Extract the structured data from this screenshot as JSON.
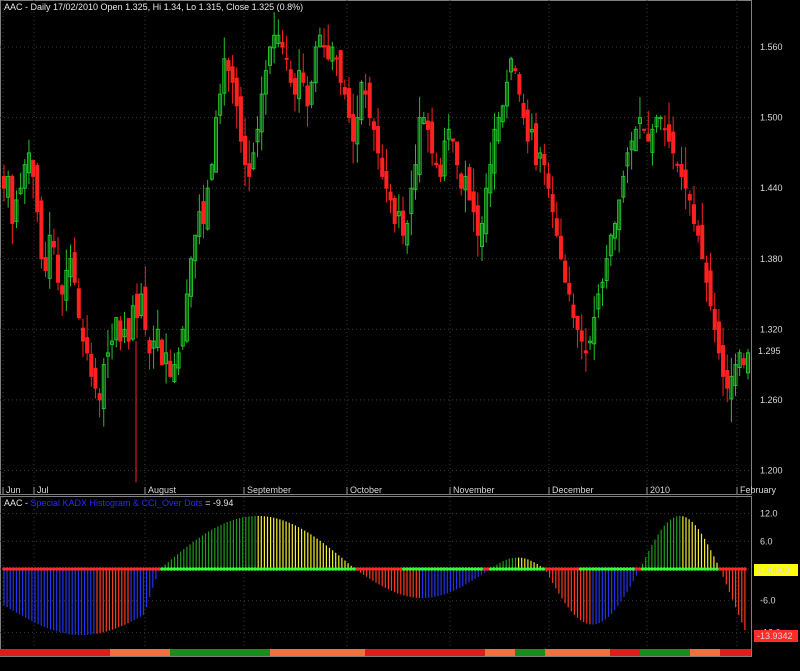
{
  "colors": {
    "background": "#000000",
    "grid": "#3a3a3a",
    "frame": "#7f7f7f",
    "candle_up": "#22c32a",
    "candle_down": "#ff2020",
    "hist_blue": "#2233ee",
    "hist_red": "#ff3a1f",
    "hist_green": "#1f9a1f",
    "hist_yellow": "#f5ef30",
    "dot_green": "#35ff35",
    "dot_red": "#ff2a2a",
    "title_ind": "#2b2bff",
    "strip_red": "#e21a1a",
    "strip_orange": "#f07040",
    "strip_green": "#1b8c1b",
    "last_price_bg": "#000000",
    "zero_tag_bg": "#ffff00",
    "neg_tag_bg": "#ff2a2a"
  },
  "price_panel": {
    "header": "AAC - Daily 17/02/2010 Open 1.325, Hi 1.34, Lo 1.315, Close 1.325 (0.8%)",
    "y_ticks": [
      "1.560",
      "1.500",
      "1.440",
      "1.380",
      "1.320",
      "1.260",
      "1.200"
    ],
    "last_price_label": "1.295",
    "x_labels": [
      "Jun",
      "Jul",
      "August",
      "September",
      "October",
      "November",
      "December",
      "2010",
      "February"
    ]
  },
  "indicator_panel": {
    "header_prefix": "AAC - ",
    "header_name": "Special KADX Histogram & CCI_Over Dots",
    "header_value": " = -9.94",
    "y_ticks": [
      "12.0",
      "6.0",
      "0",
      "-6.0",
      "-12.0"
    ],
    "zero_tag": "0.00000",
    "value_tag": "-13.9342"
  },
  "chart_data": [
    {
      "type": "candlestick",
      "title": "AAC - Daily 17/02/2010 Open 1.325, Hi 1.34, Lo 1.315, Close 1.325 (0.8%)",
      "ylim": [
        1.18,
        1.6
      ],
      "x_labels": [
        "Jun",
        "Jul",
        "August",
        "September",
        "October",
        "November",
        "December",
        "2010",
        "February"
      ],
      "last_close": 1.295,
      "closes_approx": [
        1.44,
        1.45,
        1.41,
        1.43,
        1.44,
        1.46,
        1.47,
        1.45,
        1.42,
        1.38,
        1.37,
        1.4,
        1.39,
        1.36,
        1.35,
        1.37,
        1.38,
        1.36,
        1.33,
        1.31,
        1.3,
        1.28,
        1.27,
        1.26,
        1.29,
        1.3,
        1.31,
        1.33,
        1.31,
        1.32,
        1.31,
        1.34,
        1.33,
        1.35,
        1.32,
        1.3,
        1.31,
        1.32,
        1.29,
        1.3,
        1.28,
        1.29,
        1.3,
        1.32,
        1.35,
        1.38,
        1.4,
        1.42,
        1.41,
        1.44,
        1.46,
        1.5,
        1.52,
        1.55,
        1.54,
        1.53,
        1.51,
        1.48,
        1.46,
        1.45,
        1.47,
        1.49,
        1.52,
        1.54,
        1.56,
        1.57,
        1.57,
        1.56,
        1.55,
        1.53,
        1.52,
        1.54,
        1.53,
        1.51,
        1.53,
        1.56,
        1.57,
        1.56,
        1.55,
        1.56,
        1.55,
        1.53,
        1.52,
        1.5,
        1.48,
        1.5,
        1.53,
        1.52,
        1.5,
        1.49,
        1.47,
        1.45,
        1.44,
        1.43,
        1.41,
        1.42,
        1.4,
        1.41,
        1.44,
        1.46,
        1.5,
        1.5,
        1.49,
        1.47,
        1.46,
        1.45,
        1.48,
        1.49,
        1.48,
        1.46,
        1.44,
        1.45,
        1.43,
        1.42,
        1.4,
        1.41,
        1.44,
        1.46,
        1.49,
        1.5,
        1.51,
        1.53,
        1.55,
        1.54,
        1.52,
        1.5,
        1.48,
        1.49,
        1.46,
        1.47,
        1.46,
        1.44,
        1.42,
        1.4,
        1.38,
        1.36,
        1.35,
        1.33,
        1.32,
        1.31,
        1.3,
        1.31,
        1.33,
        1.35,
        1.36,
        1.38,
        1.4,
        1.41,
        1.43,
        1.45,
        1.47,
        1.48,
        1.49,
        1.5,
        1.49,
        1.48,
        1.49,
        1.5,
        1.5,
        1.49,
        1.48,
        1.47,
        1.46,
        1.45,
        1.44,
        1.43,
        1.41,
        1.4,
        1.38,
        1.36,
        1.34,
        1.32,
        1.3,
        1.28,
        1.27,
        1.28,
        1.29,
        1.3,
        1.29,
        1.3
      ]
    },
    {
      "type": "bar",
      "title": "AAC - Special KADX Histogram & CCI_Over Dots = -9.94",
      "ylim": [
        -13.94,
        13.0
      ],
      "last_value": -13.9342,
      "colors_by_segment": [
        "blue/red negative Jun-Aug",
        "green/yellow positive Aug-Oct",
        "red/blue negative Oct-Nov",
        "green/yellow small positive Nov",
        "red/blue negative Dec-Jan",
        "green/yellow positive Jan",
        "red negative Feb"
      ]
    }
  ]
}
